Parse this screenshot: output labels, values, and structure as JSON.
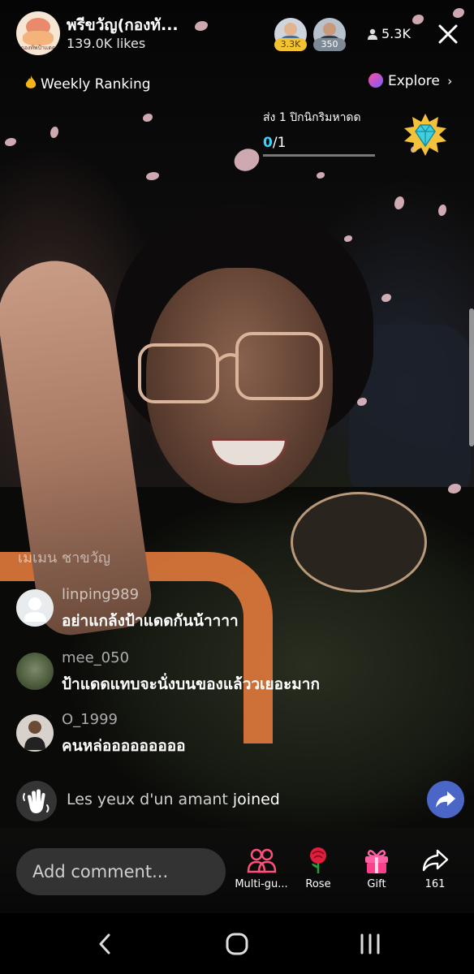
{
  "header": {
    "host_name": "พรีขวัญ(กองทั...",
    "host_likes": "139.0K likes",
    "host_logo_text": "กองทัพป้าแดด",
    "viewers": [
      {
        "badge": "3.3K",
        "badge_color": "#f2c230"
      },
      {
        "badge": "350",
        "badge_color": "#7d8a96"
      }
    ],
    "viewer_count": "5.3K"
  },
  "ranking": {
    "label": "Weekly Ranking"
  },
  "explore": {
    "label": "Explore"
  },
  "task": {
    "title": "ส่ง 1 ปิกนิกริมหาดด",
    "current": "0",
    "total": "/1",
    "progress": 0
  },
  "chat": {
    "faded_message": "เมเมน ชาขวัญ",
    "messages": [
      {
        "user": "linping989",
        "text": "อย่าแกล้งป้าแดดกันน้าาาา"
      },
      {
        "user": "mee_050",
        "text": "ป้าแดดแทบจะนั่งบนของแล้ววเยอะมาก"
      },
      {
        "user": "O_1999",
        "text": "คนหล่อออออออออ"
      }
    ],
    "joined_user": "Les yeux d'un amant",
    "joined_suffix": "joined"
  },
  "bottom": {
    "comment_placeholder": "Add comment...",
    "actions": [
      {
        "label": "Multi-gu..."
      },
      {
        "label": "Rose"
      },
      {
        "label": "Gift"
      },
      {
        "label": "161"
      }
    ]
  },
  "colors": {
    "accent_blue": "#3ad3ff",
    "share_blue": "#4a66c7",
    "collar_orange": "#e07a3c"
  }
}
